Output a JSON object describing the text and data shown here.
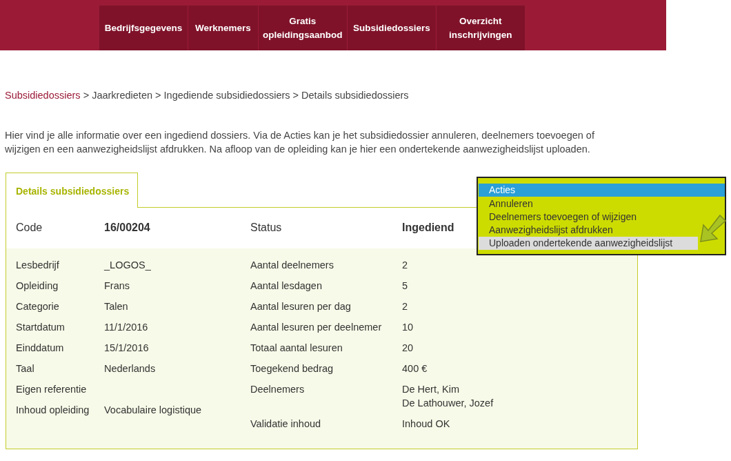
{
  "nav": [
    {
      "label": "Bedrijfsgegevens"
    },
    {
      "label": "Werknemers"
    },
    {
      "label": "Gratis opleidingsaanbod"
    },
    {
      "label": "Subsidiedossiers"
    },
    {
      "label": "Overzicht inschrijvingen"
    }
  ],
  "breadcrumb": [
    {
      "label": "Subsidiedossiers",
      "link": true
    },
    {
      "label": "Jaarkredieten",
      "link": false
    },
    {
      "label": "Ingediende subsidiedossiers",
      "link": false
    },
    {
      "label": "Details subsidiedossiers",
      "link": false
    }
  ],
  "breadcrumb_separator": ">",
  "intro": "Hier vind je alle informatie over een ingediend dossiers. Via de Acties kan je het subsidiedossier annuleren, deelnemers toevoegen of wijzigen en een aanwezigheidslijst afdrukken. Na afloop van de opleiding kan je hier een ondertekende aanwezigheidslijst uploaden.",
  "tabs": [
    {
      "label": "Details subsidiedossiers",
      "selected": true
    }
  ],
  "summary": {
    "code_label": "Code",
    "code": "16/00204",
    "status_label": "Status",
    "status": "Ingediend"
  },
  "left_fields": [
    {
      "label": "Lesbedrijf",
      "value": "_LOGOS_"
    },
    {
      "label": "Opleiding",
      "value": "Frans"
    },
    {
      "label": "Categorie",
      "value": "Talen"
    },
    {
      "label": "Startdatum",
      "value": "11/1/2016"
    },
    {
      "label": "Einddatum",
      "value": "15/1/2016"
    },
    {
      "label": "Taal",
      "value": "Nederlands"
    },
    {
      "label": "Eigen referentie"
    },
    {
      "label": "Inhoud opleiding",
      "value": "Vocabulaire logistique"
    }
  ],
  "right_fields": [
    {
      "label": "Aantal deelnemers",
      "value": [
        "2"
      ]
    },
    {
      "label": "Aantal lesdagen",
      "value": [
        "5"
      ]
    },
    {
      "label": "Aantal lesuren per dag",
      "value": [
        "2"
      ]
    },
    {
      "label": "Aantal lesuren per deelnemer",
      "value": [
        "10"
      ]
    },
    {
      "label": "Totaal aantal lesuren",
      "value": [
        "20"
      ]
    },
    {
      "label": "Toegekend bedrag",
      "value": [
        "400 €"
      ]
    },
    {
      "label": "Deelnemers",
      "value": [
        "De Hert, Kim",
        "De Lathouwer, Jozef"
      ]
    },
    {
      "label": "Validatie inhoud",
      "value": [
        "Inhoud OK"
      ]
    }
  ],
  "actions": {
    "title": "Acties",
    "items": [
      {
        "label": "Annuleren",
        "selected": false
      },
      {
        "label": "Deelnemers toevoegen of wijzigen",
        "selected": false
      },
      {
        "label": "Aanwezigheidslijst afdrukken",
        "selected": false
      },
      {
        "label": "Uploaden ondertekende aanwezigheidslijst",
        "selected": true
      }
    ]
  }
}
